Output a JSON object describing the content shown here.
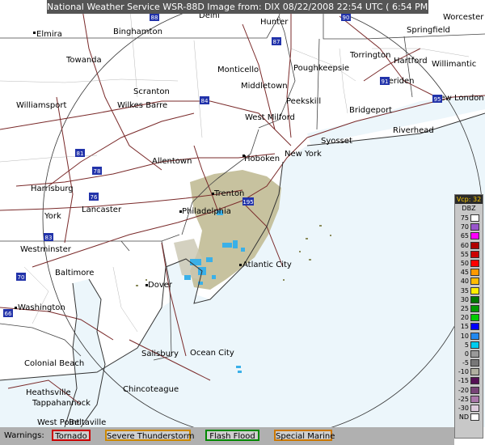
{
  "header": "National Weather Service WSR-88D Image from: DIX 08/22/2008 22:54 UTC ( 6:54 PM EDT)",
  "legend": {
    "vcp": "Vcp: 32",
    "unit": "DBZ",
    "levels": [
      {
        "label": "75",
        "color": "#ffffff"
      },
      {
        "label": "70",
        "color": "#9955cc"
      },
      {
        "label": "65",
        "color": "#ff00ff"
      },
      {
        "label": "60",
        "color": "#b00000"
      },
      {
        "label": "55",
        "color": "#cc0000"
      },
      {
        "label": "50",
        "color": "#ff0000"
      },
      {
        "label": "45",
        "color": "#ff9900"
      },
      {
        "label": "40",
        "color": "#ffbb00"
      },
      {
        "label": "35",
        "color": "#ffee00"
      },
      {
        "label": "30",
        "color": "#007700"
      },
      {
        "label": "25",
        "color": "#009900"
      },
      {
        "label": "20",
        "color": "#00cc00"
      },
      {
        "label": "15",
        "color": "#0000ff"
      },
      {
        "label": "10",
        "color": "#2288ee"
      },
      {
        "label": "5",
        "color": "#00ccee"
      },
      {
        "label": "0",
        "color": "#999999"
      },
      {
        "label": "-5",
        "color": "#777777"
      },
      {
        "label": "-10",
        "color": "#b0b0a0"
      },
      {
        "label": "-15",
        "color": "#551155"
      },
      {
        "label": "-20",
        "color": "#774477"
      },
      {
        "label": "-25",
        "color": "#aa77aa"
      },
      {
        "label": "-30",
        "color": "#ddccdd"
      },
      {
        "label": "ND",
        "color": "#ffffff"
      }
    ]
  },
  "warnings": {
    "label": "Warnings:",
    "items": [
      {
        "label": "Tornado",
        "color": "#cc0000"
      },
      {
        "label": "Severe Thunderstorm",
        "color": "#cc8800"
      },
      {
        "label": "Flash Flood",
        "color": "#008800"
      },
      {
        "label": "Special Marine",
        "color": "#cc7700"
      }
    ]
  },
  "cities": [
    {
      "name": "Delhi"
    },
    {
      "name": "Hunter"
    },
    {
      "name": "Worcester"
    },
    {
      "name": "Elmira"
    },
    {
      "name": "Binghamton"
    },
    {
      "name": "Springfield"
    },
    {
      "name": "Towanda"
    },
    {
      "name": "Torrington"
    },
    {
      "name": "Hartford"
    },
    {
      "name": "Monticello"
    },
    {
      "name": "Poughkeepsie"
    },
    {
      "name": "Willimantic"
    },
    {
      "name": "Meriden"
    },
    {
      "name": "Scranton"
    },
    {
      "name": "Middletown"
    },
    {
      "name": "New London"
    },
    {
      "name": "Williamsport"
    },
    {
      "name": "Wilkes Barre"
    },
    {
      "name": "Peekskill"
    },
    {
      "name": "Bridgeport"
    },
    {
      "name": "West Milford"
    },
    {
      "name": "Riverhead"
    },
    {
      "name": "Syosset"
    },
    {
      "name": "New York"
    },
    {
      "name": "Allentown"
    },
    {
      "name": "Hoboken"
    },
    {
      "name": "Harrisburg"
    },
    {
      "name": "Trenton"
    },
    {
      "name": "Lancaster"
    },
    {
      "name": "Philadelphia"
    },
    {
      "name": "York"
    },
    {
      "name": "Westminster"
    },
    {
      "name": "Atlantic City"
    },
    {
      "name": "Baltimore"
    },
    {
      "name": "Dover"
    },
    {
      "name": "Washington"
    },
    {
      "name": "Salisbury"
    },
    {
      "name": "Ocean City"
    },
    {
      "name": "Colonial Beach"
    },
    {
      "name": "Chincoteague"
    },
    {
      "name": "Heathsville"
    },
    {
      "name": "Tappahannock"
    },
    {
      "name": "West Point"
    },
    {
      "name": "Beltaville"
    }
  ],
  "highways": [
    {
      "label": "88"
    },
    {
      "label": "90"
    },
    {
      "label": "87"
    },
    {
      "label": "84"
    },
    {
      "label": "91"
    },
    {
      "label": "95"
    },
    {
      "label": "81"
    },
    {
      "label": "78"
    },
    {
      "label": "76"
    },
    {
      "label": "83"
    },
    {
      "label": "195"
    },
    {
      "label": "70"
    },
    {
      "label": "66"
    }
  ]
}
